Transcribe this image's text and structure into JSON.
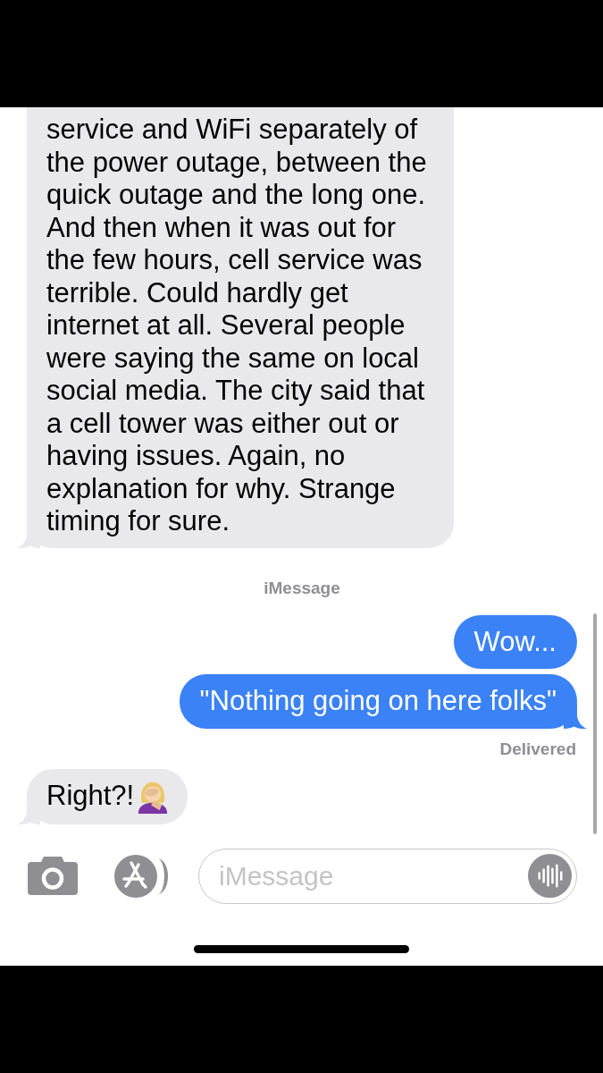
{
  "thread": [
    {
      "kind": "received",
      "text": "service and WiFi separately of the power outage, between the quick outage and the long one. And then when it was out for the few hours, cell service was terrible. Could hardly get internet at all. Several people were saying the same on local social media. The city said that a cell tower was either out or having issues. Again, no explanation for why. Strange timing for sure.",
      "tail": true,
      "cut_off_top": true,
      "emoji": false
    },
    {
      "kind": "service_label",
      "text": "iMessage"
    },
    {
      "kind": "sent",
      "text": "Wow...",
      "tail": false,
      "cut_off_top": false,
      "emoji": false
    },
    {
      "kind": "sent",
      "text": "\"Nothing going on here folks\"",
      "tail": true,
      "cut_off_top": false,
      "emoji": false
    },
    {
      "kind": "status",
      "text": "Delivered"
    },
    {
      "kind": "received",
      "text": "Right?!",
      "tail": true,
      "cut_off_top": false,
      "emoji": true
    }
  ],
  "composer": {
    "placeholder": "iMessage"
  }
}
